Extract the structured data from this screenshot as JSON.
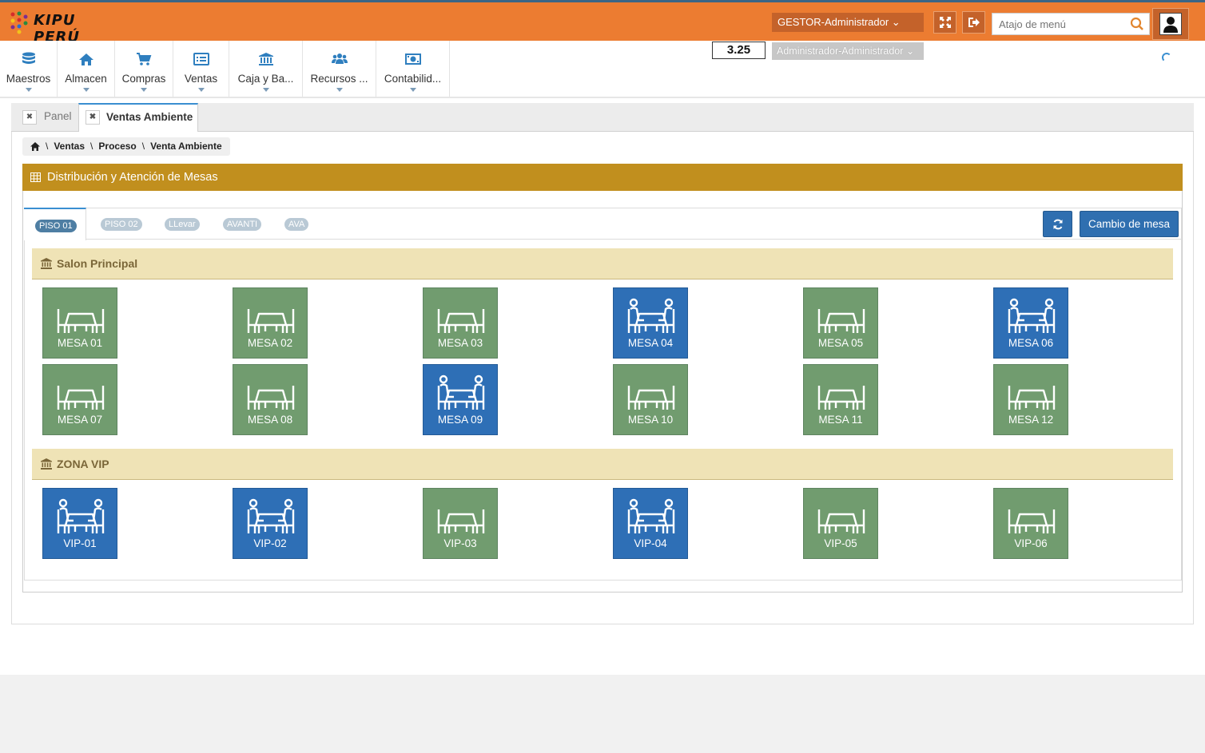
{
  "brand": {
    "name": "KIPU PERÚ"
  },
  "topbar": {
    "user_role": "GESTOR-Administrador ⌄",
    "fullscreen_icon": "expand-icon",
    "logout_icon": "sign-out-icon",
    "search_placeholder": "Atajo de menú",
    "search_icon": "search-icon",
    "avatar_icon": "user-avatar-icon"
  },
  "menubar": {
    "items": [
      {
        "label": "Maestros",
        "icon": "database-icon"
      },
      {
        "label": "Almacen",
        "icon": "home-icon"
      },
      {
        "label": "Compras",
        "icon": "cart-icon"
      },
      {
        "label": "Ventas",
        "icon": "list-alt-icon"
      },
      {
        "label": "Caja y Ba...",
        "icon": "bank-icon"
      },
      {
        "label": "Recursos ...",
        "icon": "users-icon"
      },
      {
        "label": "Contabilid...",
        "icon": "money-icon"
      }
    ],
    "exchange_rate": "3.25",
    "user_alt": "Administrador-Administrador ⌄"
  },
  "tabs": [
    {
      "label": "Panel",
      "active": false
    },
    {
      "label": "Ventas Ambiente",
      "active": true
    }
  ],
  "breadcrumb": [
    "Ventas",
    "Proceso",
    "Venta Ambiente"
  ],
  "panel": {
    "title": "Distribución y Atención de Mesas",
    "floors": [
      "PISO 01",
      "PISO 02",
      "LLevar",
      "AVANTI",
      "AVA"
    ],
    "active_floor": "PISO 01",
    "change_table_button": "Cambio de mesa"
  },
  "zones": [
    {
      "name": "Salon Principal",
      "tables": [
        {
          "label": "MESA 01",
          "status": "free"
        },
        {
          "label": "MESA 02",
          "status": "free"
        },
        {
          "label": "MESA 03",
          "status": "free"
        },
        {
          "label": "MESA 04",
          "status": "occupied"
        },
        {
          "label": "MESA 05",
          "status": "free"
        },
        {
          "label": "MESA 06",
          "status": "occupied"
        },
        {
          "label": "MESA 07",
          "status": "free"
        },
        {
          "label": "MESA 08",
          "status": "free"
        },
        {
          "label": "MESA 09",
          "status": "occupied"
        },
        {
          "label": "MESA 10",
          "status": "free"
        },
        {
          "label": "MESA 11",
          "status": "free"
        },
        {
          "label": "MESA 12",
          "status": "free"
        }
      ]
    },
    {
      "name": "ZONA VIP",
      "tables": [
        {
          "label": "VIP-01",
          "status": "occupied"
        },
        {
          "label": "VIP-02",
          "status": "occupied"
        },
        {
          "label": "VIP-03",
          "status": "free"
        },
        {
          "label": "VIP-04",
          "status": "occupied"
        },
        {
          "label": "VIP-05",
          "status": "free"
        },
        {
          "label": "VIP-06",
          "status": "free"
        }
      ]
    }
  ],
  "colors": {
    "header_orange": "#ec7c31",
    "panel_gold": "#c18f1e",
    "table_free": "#719c6f",
    "table_occupied": "#2e6fb6",
    "zone_bg": "#efe3b6"
  }
}
